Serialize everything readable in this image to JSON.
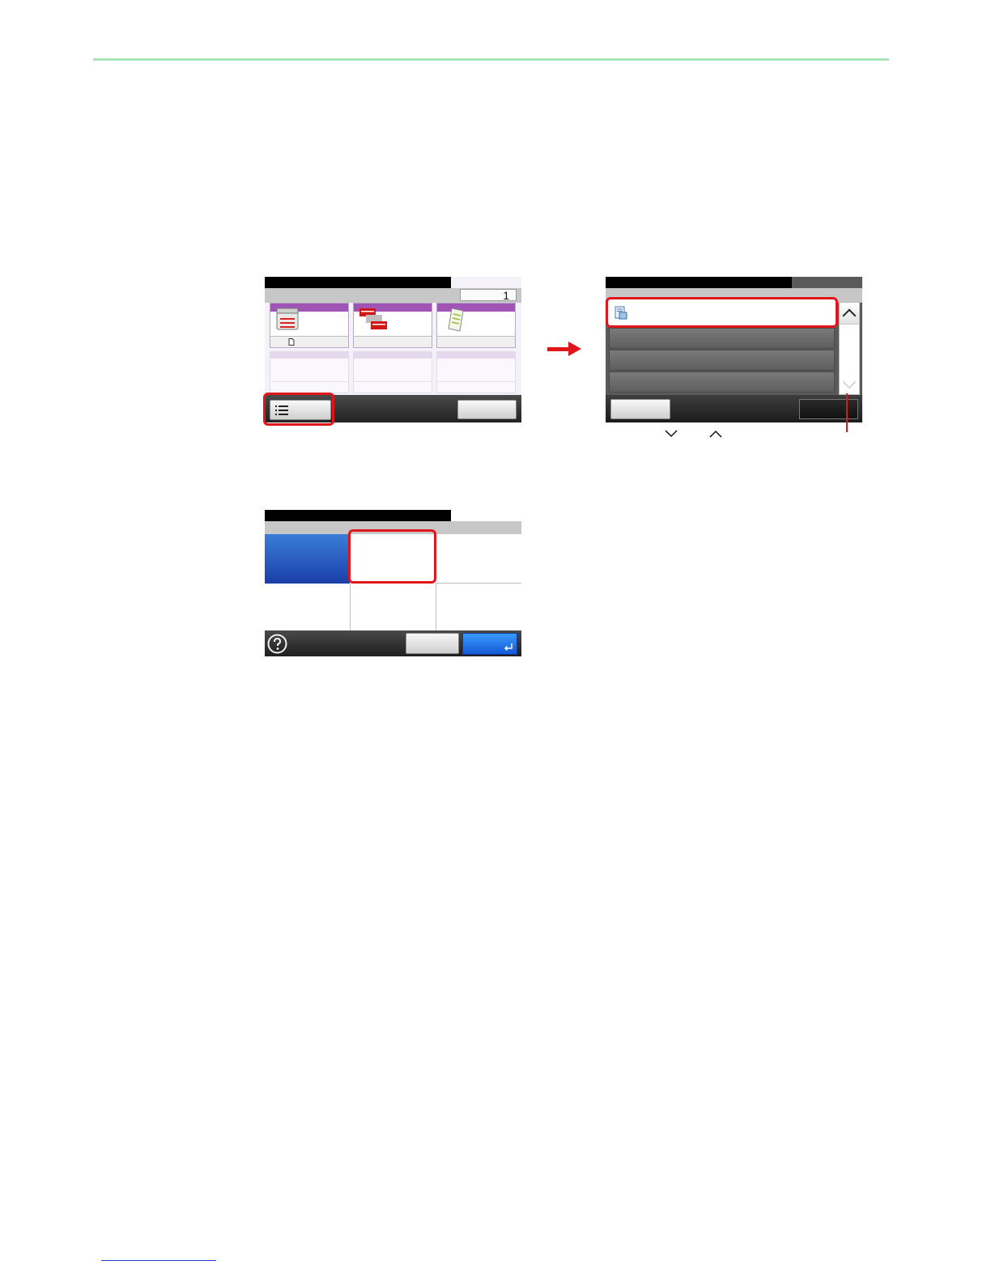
{
  "screens": {
    "screen1": {
      "page_counter": "1"
    }
  },
  "colors": {
    "accent_red": "#e0161b",
    "rule_green": "#a8e6b8",
    "tile_purple": "#a054b6",
    "ok_blue": "#1f6fe6"
  },
  "icons": {
    "screen1": [
      "copier-icon",
      "paper-icon",
      "collate-icon",
      "document-icon",
      "list-icon"
    ],
    "screen2": [
      "document-icon",
      "scroll-up-icon",
      "scroll-down-icon"
    ],
    "screen3": [
      "help-icon",
      "enter-icon"
    ],
    "caption": [
      "chevron-down-icon",
      "chevron-up-icon"
    ]
  }
}
